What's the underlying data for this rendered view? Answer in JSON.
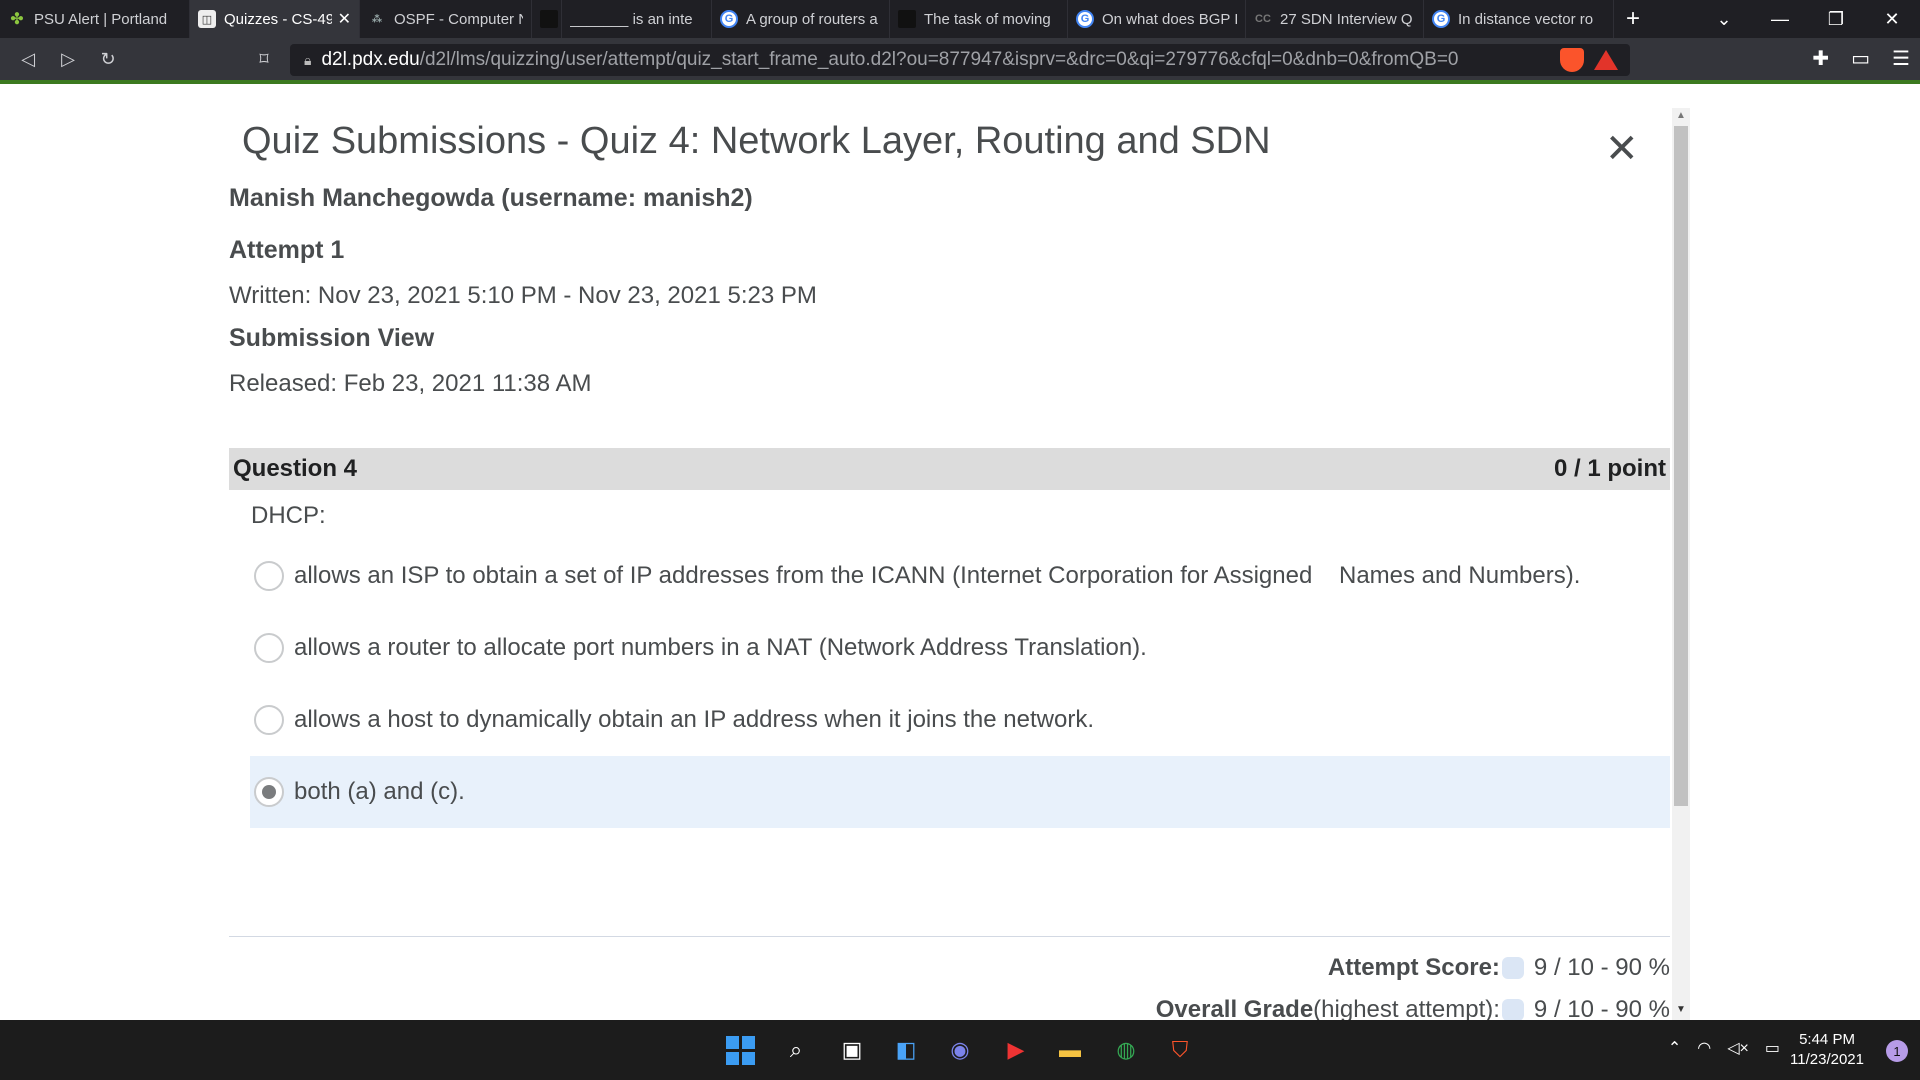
{
  "browser": {
    "tabs": [
      {
        "label": "PSU Alert | Portland",
        "icon": "psu-icon",
        "active": false,
        "w": 190
      },
      {
        "label": "Quizzes - CS-49",
        "icon": "d2l-icon",
        "active": true,
        "w": 170
      },
      {
        "label": "OSPF - Computer N",
        "icon": "ospf-icon",
        "active": false,
        "w": 172
      },
      {
        "label": "",
        "icon": "blank-icon",
        "active": false,
        "w": 30
      },
      {
        "label": "_______ is an inte",
        "icon": "",
        "active": false,
        "w": 150
      },
      {
        "label": "A group of routers a",
        "icon": "google-icon",
        "active": false,
        "w": 178
      },
      {
        "label": "The task of moving",
        "icon": "blank-icon",
        "active": false,
        "w": 178
      },
      {
        "label": "On what does BGP I",
        "icon": "google-icon",
        "active": false,
        "w": 178
      },
      {
        "label": "27 SDN Interview Q",
        "icon": "cc-icon",
        "active": false,
        "w": 178
      },
      {
        "label": "In distance vector ro",
        "icon": "google-icon",
        "active": false,
        "w": 190
      }
    ],
    "url_host": "d2l.pdx.edu",
    "url_path": "/d2l/lms/quizzing/user/attempt/quiz_start_frame_auto.d2l?ou=877947&isprv=&drc=0&qi=279776&cfql=0&dnb=0&fromQB=0",
    "brave_badge": "2"
  },
  "page": {
    "title": "Quiz Submissions - Quiz 4: Network Layer, Routing and SDN",
    "user": "Manish Manchegowda (username: manish2)",
    "attempt": "Attempt 1",
    "written": "Written: Nov 23, 2021 5:10 PM - Nov 23, 2021 5:23 PM",
    "submission_view": "Submission View",
    "released": "Released: Feb 23, 2021 11:38 AM",
    "question": {
      "label": "Question 4",
      "points": "0 / 1 point",
      "text": "DHCP:",
      "options": [
        "allows an ISP to obtain a set of IP addresses from the ICANN (Internet Corporation for Assigned    Names and Numbers).",
        "allows a router to allocate port numbers in a NAT (Network Address Translation).",
        "allows a host to dynamically obtain an IP address when it joins the network.",
        "both (a) and (c)."
      ],
      "selected_index": 3
    },
    "attempt_score_label": "Attempt Score:",
    "attempt_score_value": "9 / 10 - 90 %",
    "overall_grade_label": "Overall Grade",
    "overall_grade_sub": " (highest attempt):",
    "overall_grade_value": "9 / 10 - 90 %"
  },
  "taskbar": {
    "time": "5:44 PM",
    "date": "11/23/2021",
    "notifications": "1"
  }
}
